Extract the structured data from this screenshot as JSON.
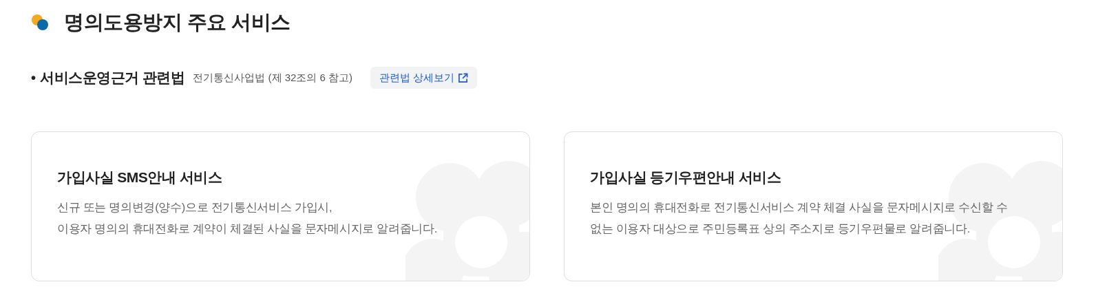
{
  "title": "명의도용방지 주요 서비스",
  "law": {
    "bullet": "•",
    "label": "서비스운영근거 관련법",
    "reference": "전기통신사업법 (제 32조의 6 참고)",
    "link": "관련법 상세보기"
  },
  "cards": [
    {
      "title": "가입사실 SMS안내 서비스",
      "lines": [
        "신규 또는 명의변경(양수)으로 전기통신서비스 가입시,",
        "이용자 명의의 휴대전화로 계약이 체결된 사실을 문자메시지로 알려줍니다."
      ]
    },
    {
      "title": "가입사실 등기우편안내 서비스",
      "lines": [
        "본인 명의의 휴대전화로 전기통신서비스 계약 체결 사실을 문자메시지로 수신할 수",
        "없는 이용자 대상으로 주민등록표 상의 주소지로 등기우편물로 알려줍니다."
      ]
    }
  ]
}
